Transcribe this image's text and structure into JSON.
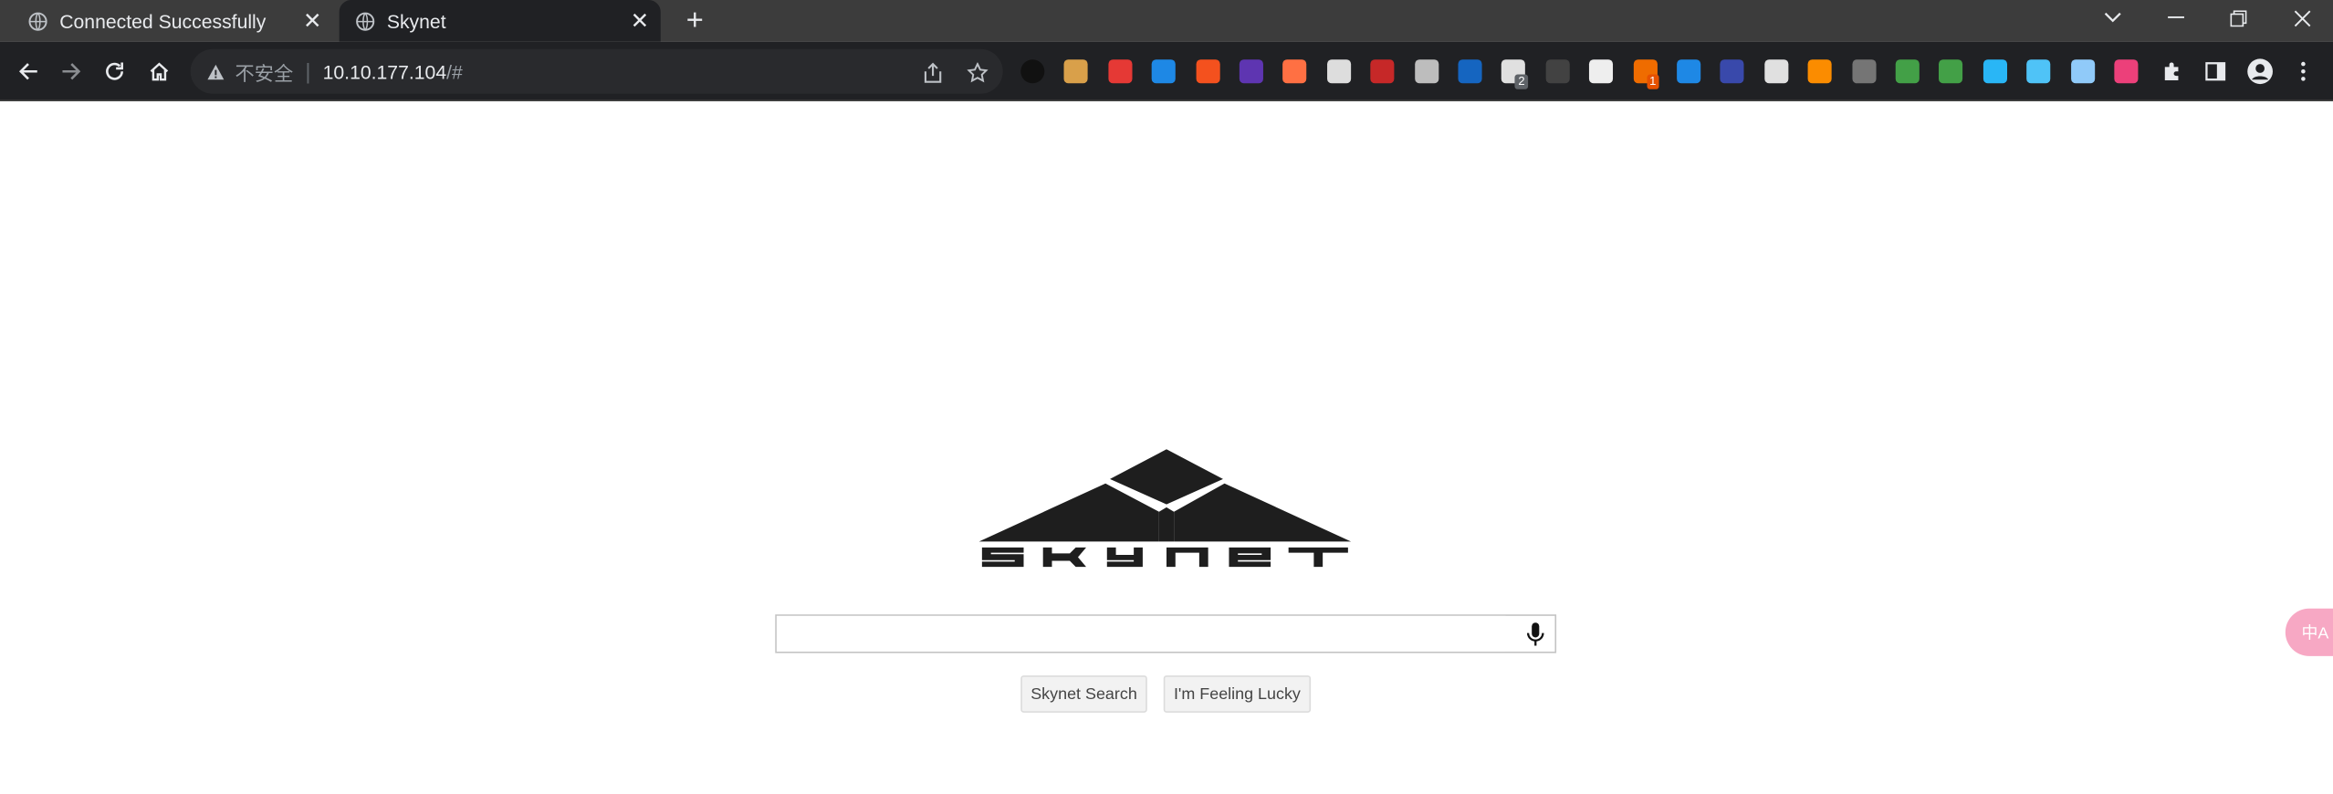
{
  "tabs": [
    {
      "title": "Connected Successfully",
      "active": false
    },
    {
      "title": "Skynet",
      "active": true
    }
  ],
  "omnibox": {
    "security_label": "不安全",
    "url_host": "10.10.177.104",
    "url_path": "/#"
  },
  "extensions": [
    {
      "name": "circle-ext-icon",
      "color": "#111111"
    },
    {
      "name": "cookie-ext-icon",
      "color": "#d9a04a"
    },
    {
      "name": "cube-ext-icon",
      "color": "#e53935"
    },
    {
      "name": "mask-ext-icon",
      "color": "#1e88e5"
    },
    {
      "name": "translate-ext-icon",
      "color": "#f4511e"
    },
    {
      "name": "layers-ext-icon",
      "color": "#5e35b1"
    },
    {
      "name": "firefox-ext-icon",
      "color": "#ff7043"
    },
    {
      "name": "cloud-ext-icon",
      "color": "#dddddd"
    },
    {
      "name": "flag-ext-icon",
      "color": "#c62828"
    },
    {
      "name": "ip-ext-icon",
      "color": "#bdbdbd"
    },
    {
      "name": "wave-ext-icon",
      "color": "#1565c0"
    },
    {
      "name": "qr-ext-icon",
      "color": "#e0e0e0",
      "badge": "2"
    },
    {
      "name": "hat-ext-icon",
      "color": "#424242"
    },
    {
      "name": "ghost-ext-icon",
      "color": "#eeeeee"
    },
    {
      "name": "hook-ext-icon",
      "color": "#ef6c00",
      "badge": "1"
    },
    {
      "name": "bars-ext-icon",
      "color": "#1e88e5"
    },
    {
      "name": "moon-ext-icon",
      "color": "#3949ab"
    },
    {
      "name": "glasses-ext-icon",
      "color": "#e0e0e0"
    },
    {
      "name": "arrow-ext-icon",
      "color": "#fb8c00"
    },
    {
      "name": "copy-ext-icon",
      "color": "#757575"
    },
    {
      "name": "gear-ext-icon",
      "color": "#43a047"
    },
    {
      "name": "grid-ext-icon",
      "color": "#43a047"
    },
    {
      "name": "diamond-ext-icon",
      "color": "#29b6f6"
    },
    {
      "name": "screen-ext-icon",
      "color": "#4fc3f7"
    },
    {
      "name": "star-ext-icon",
      "color": "#90caf9"
    },
    {
      "name": "translate2-ext-icon",
      "color": "#ec407a"
    }
  ],
  "page": {
    "logo_text": "SKYNET",
    "search_value": "",
    "search_button": "Skynet Search",
    "lucky_button": "I'm Feeling Lucky"
  },
  "translate_fab": "中A",
  "colors": {
    "tabstrip": "#3c3c3c",
    "toolbar": "#202124",
    "omnibox": "#292a2d"
  }
}
